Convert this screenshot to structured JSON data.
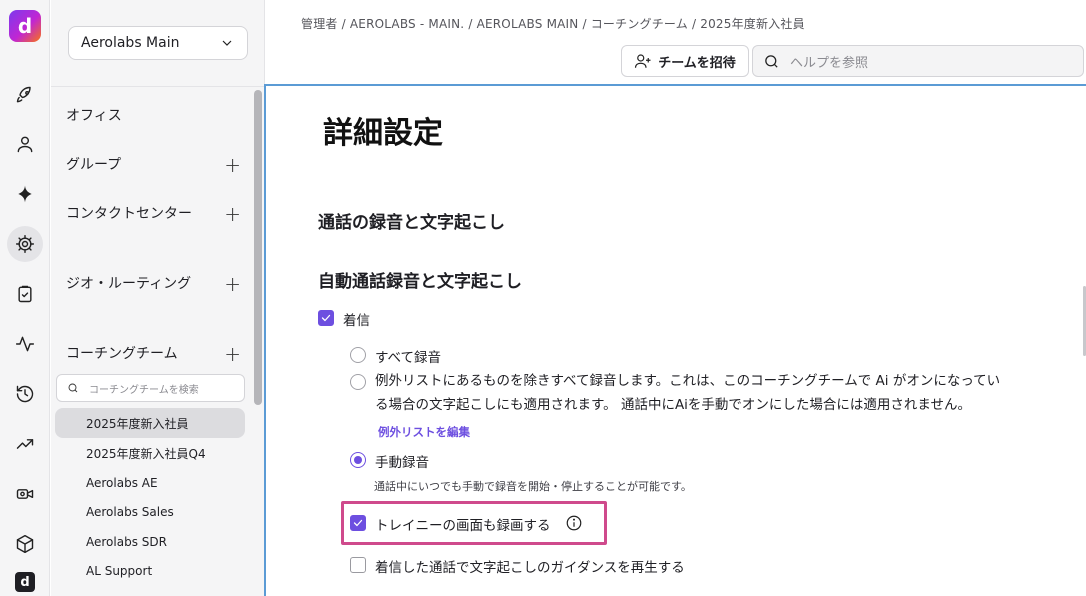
{
  "sidebar": {
    "org_name": "Aerolabs Main",
    "nav": [
      {
        "label": "オフィス",
        "has_add": false
      },
      {
        "label": "グループ",
        "has_add": true
      },
      {
        "label": "コンタクトセンター",
        "has_add": true
      },
      {
        "label": "ジオ・ルーティング",
        "has_add": true
      },
      {
        "label": "コーチングチーム",
        "has_add": true
      }
    ],
    "add_symbol": "+",
    "team_search_placeholder": "コーチングチームを検索",
    "teams": [
      {
        "label": "2025年度新入社員",
        "selected": true
      },
      {
        "label": "2025年度新入社員Q4",
        "selected": false
      },
      {
        "label": "Aerolabs AE",
        "selected": false
      },
      {
        "label": "Aerolabs Sales",
        "selected": false
      },
      {
        "label": "Aerolabs SDR",
        "selected": false
      },
      {
        "label": "AL Support",
        "selected": false
      }
    ]
  },
  "rail": {
    "logo": "d",
    "icons": [
      "rocket-icon",
      "user-icon",
      "sparkle-icon",
      "gear-icon",
      "clipboard-icon",
      "activity-icon",
      "history-icon",
      "trending-icon",
      "video-icon",
      "box-icon"
    ],
    "active": "gear-icon"
  },
  "header": {
    "breadcrumb": "管理者 / AEROLABS - MAIN. / AEROLABS MAIN / コーチングチーム / 2025年度新入社員",
    "invite_label": "チームを招待",
    "help_placeholder": "ヘルプを参照"
  },
  "main": {
    "title": "詳細設定",
    "section1_title": "通話の録音と文字起こし",
    "section2_title": "自動通話録音と文字起こし",
    "incoming_label": "着信",
    "incoming_checked": true,
    "options": {
      "record_all": "すべて録音",
      "record_except_line1": "例外リストにあるものを除きすべて録音します。これは、このコーチングチームで Ai がオンになってい",
      "record_except_line2": "る場合の文字起こしにも適用されます。 通話中にAiを手動でオンにした場合には適用されません。",
      "edit_exception_link": "例外リストを編集",
      "manual_record": "手動録音",
      "manual_record_desc": "通話中にいつでも手動で録音を開始・停止することが可能です。",
      "selected": "manual_record"
    },
    "trainee_screen_label": "トレイニーの画面も録画する",
    "trainee_screen_checked": true,
    "guidance_label": "着信した通話で文字起こしのガイダンスを再生する",
    "guidance_checked": false
  }
}
